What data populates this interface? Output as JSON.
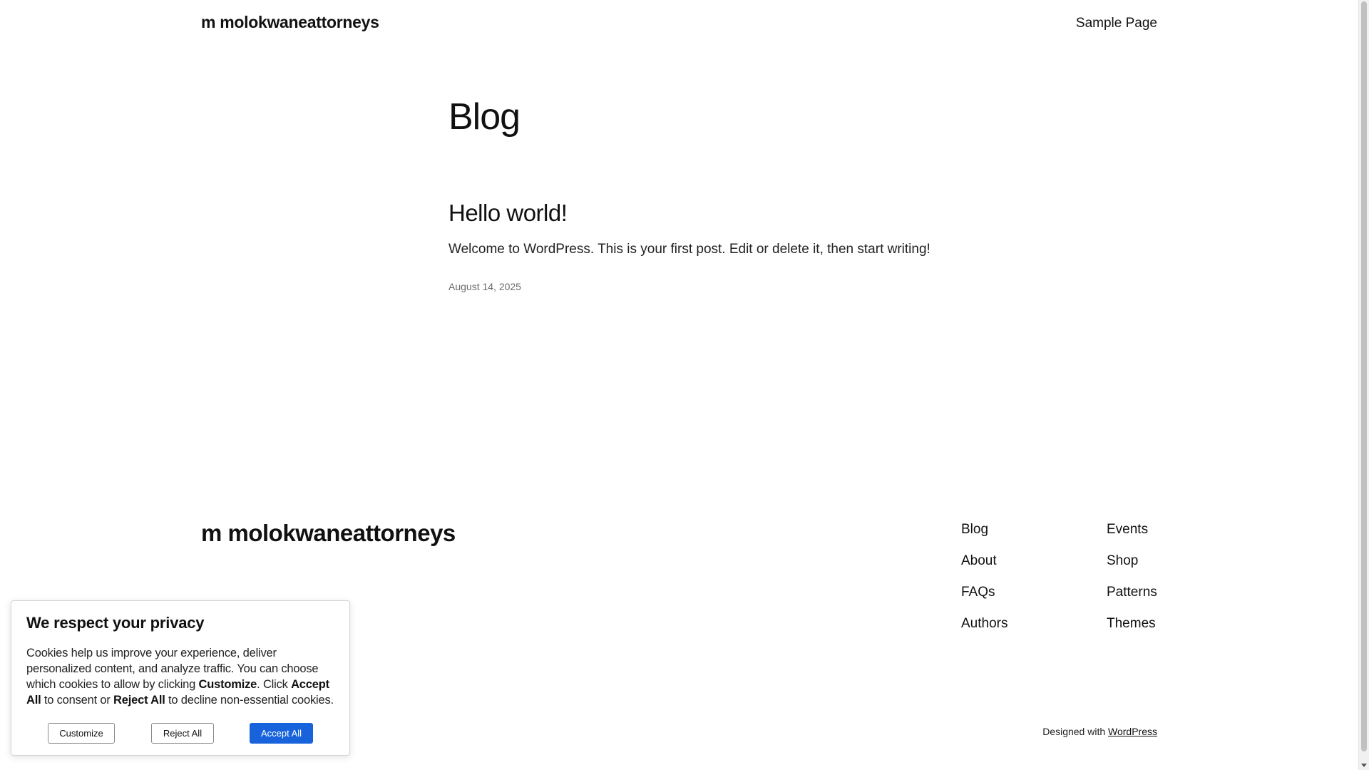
{
  "header": {
    "site_title": "m molokwaneattorneys",
    "nav": [
      "Sample Page"
    ]
  },
  "main": {
    "heading": "Blog",
    "posts": [
      {
        "title": "Hello world!",
        "excerpt": "Welcome to WordPress. This is your first post. Edit or delete it, then start writing!",
        "date": "August 14, 2025"
      }
    ]
  },
  "footer": {
    "site_title": "m molokwaneattorneys",
    "links_col1": [
      "Blog",
      "About",
      "FAQs",
      "Authors"
    ],
    "links_col2": [
      "Events",
      "Shop",
      "Patterns",
      "Themes"
    ],
    "credit_prefix": "Designed with",
    "credit_link": "WordPress"
  },
  "cookie_banner": {
    "title": "We respect your privacy",
    "text_1": "Cookies help us improve your experience, deliver personalized content, and analyze traffic. You can choose which cookies to allow by clicking ",
    "bold_customize": "Customize",
    "text_2": ". Click ",
    "bold_accept": "Accept All",
    "text_3": " to consent or ",
    "bold_reject": "Reject All",
    "text_4": " to decline non-essential cookies.",
    "buttons": {
      "customize": "Customize",
      "reject": "Reject All",
      "accept": "Accept All"
    },
    "accent_color": "#1863dc"
  }
}
